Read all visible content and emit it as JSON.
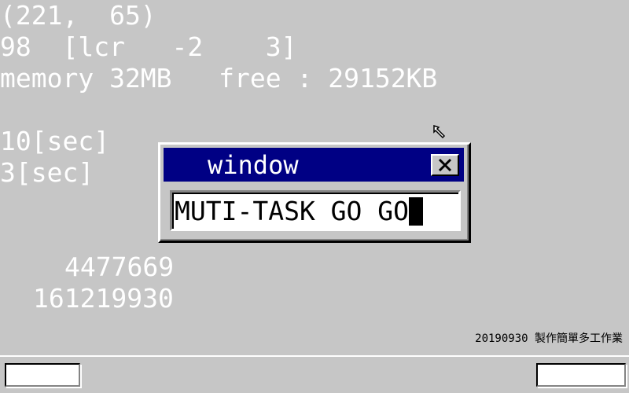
{
  "screen": {
    "coords": "(221,  65)",
    "mouse_line": "98  [lcr   -2    3]",
    "memory_line": "memory 32MB   free : 29152KB",
    "timer1": "10[sec]",
    "timer2": "3[sec]",
    "count1": "4477669",
    "count2": "161219930",
    "caption": "20190930 製作簡單多工作業"
  },
  "window": {
    "title": "window",
    "close_icon": "close-x-icon",
    "textbox_value": "MUTI-TASK GO GO"
  },
  "cursor": {
    "icon": "mouse-arrow-icon"
  },
  "colors": {
    "desktop": "#c6c6c6",
    "titlebar": "#000084",
    "text": "#ffffff"
  }
}
